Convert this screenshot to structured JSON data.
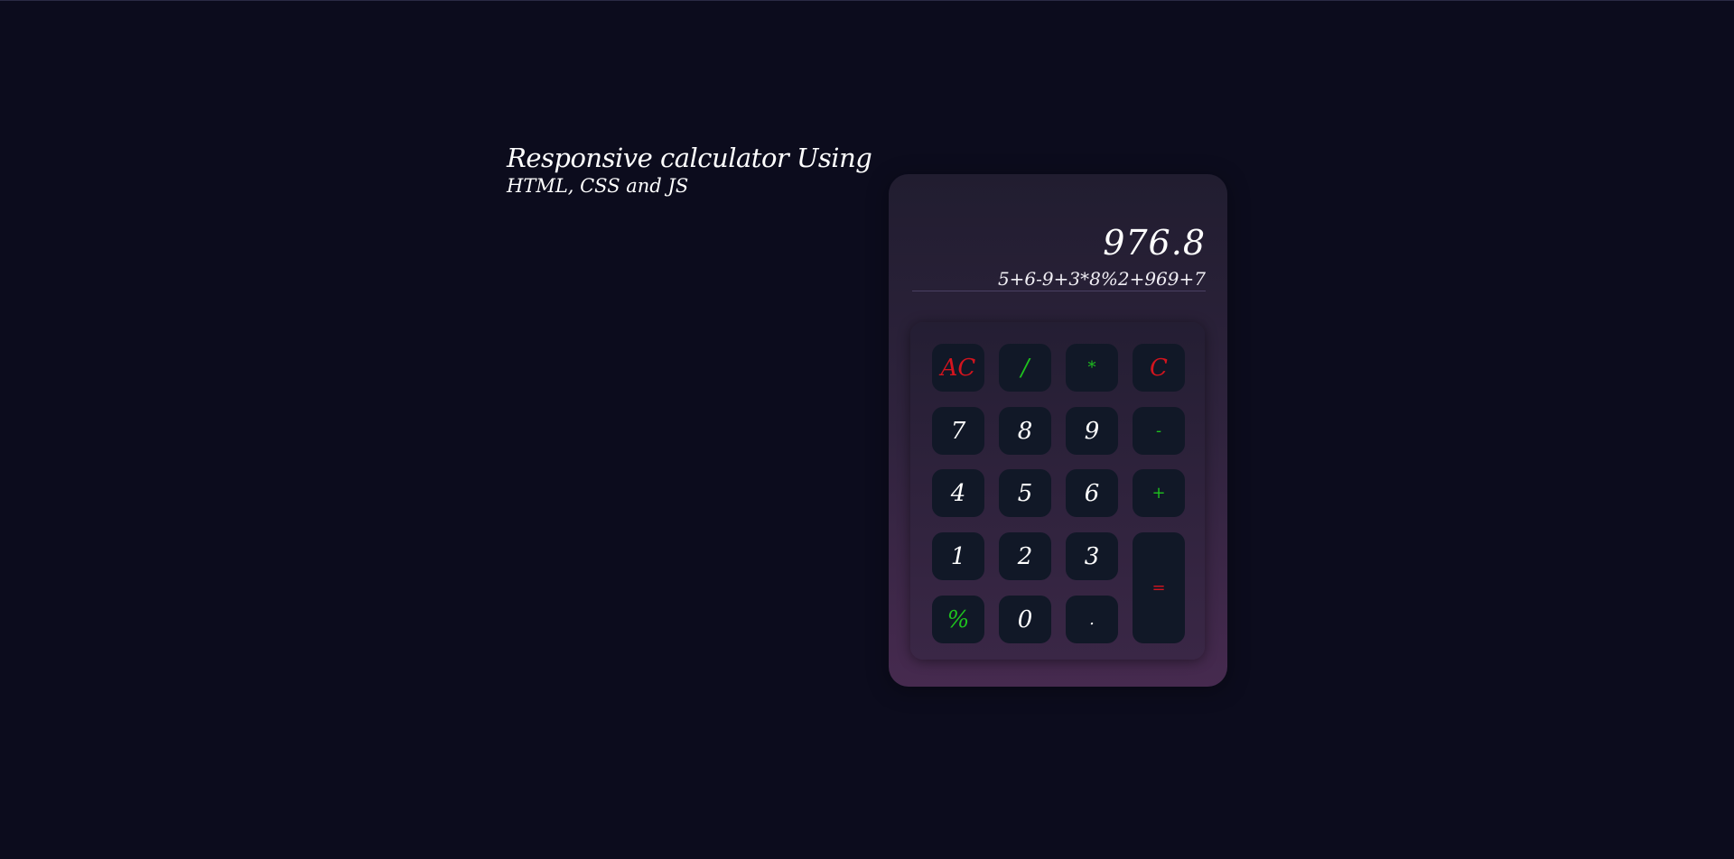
{
  "heading": {
    "line1": "Responsive calculator Using",
    "line2": "HTML, CSS and JS"
  },
  "display": {
    "result": "976.8",
    "expression": "5+6-9+3*8%2+969+7"
  },
  "keys": {
    "ac": "AC",
    "divide": "/",
    "multiply": "*",
    "clear": "C",
    "seven": "7",
    "eight": "8",
    "nine": "9",
    "minus": "-",
    "four": "4",
    "five": "5",
    "six": "6",
    "plus": "+",
    "one": "1",
    "two": "2",
    "three": "3",
    "equals": "=",
    "percent": "%",
    "zero": "0",
    "dot": "."
  },
  "colors": {
    "background": "#0c0c1d",
    "key_background": "#111827",
    "accent_red": "#d4141e",
    "accent_green": "#1ec21e"
  }
}
